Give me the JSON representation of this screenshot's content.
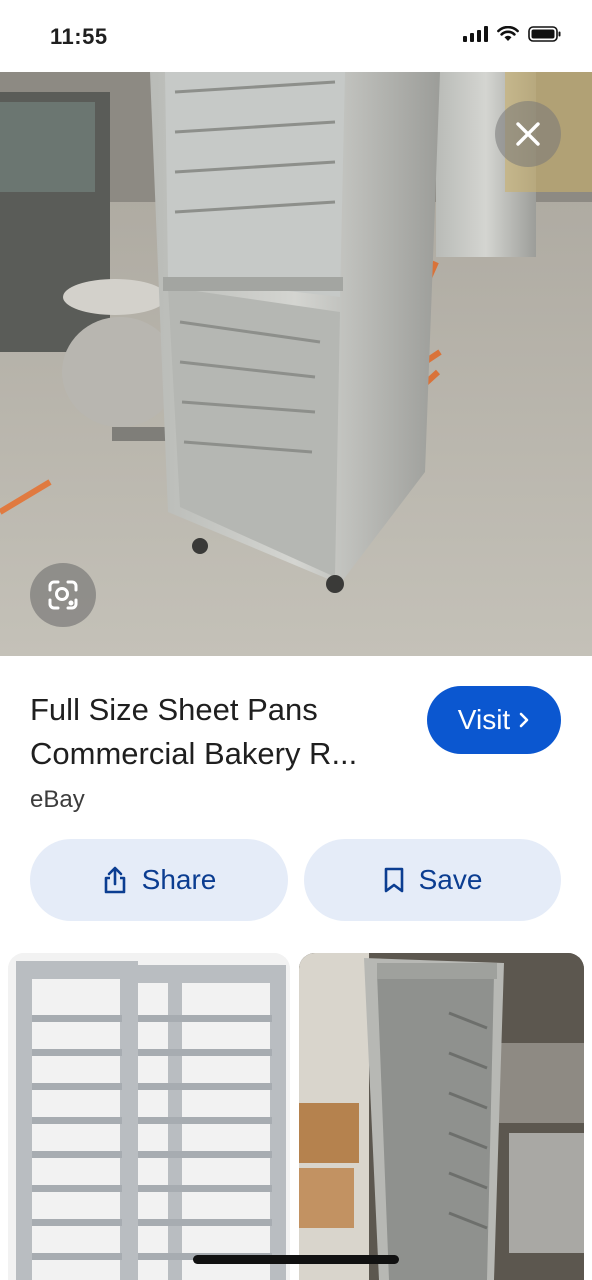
{
  "status": {
    "time": "11:55"
  },
  "result": {
    "title_line1": "Full Size Sheet Pans",
    "title_line2": "Commercial Bakery R...",
    "source": "eBay",
    "visit_label": "Visit"
  },
  "actions": {
    "share_label": "Share",
    "save_label": "Save"
  },
  "colors": {
    "accent": "#0b57d0",
    "pill_bg": "#e5ecf8",
    "pill_text": "#0b3d91"
  },
  "icons": [
    "signal-icon",
    "wifi-icon",
    "battery-icon",
    "close-icon",
    "lens-icon",
    "chevron-right-icon",
    "share-icon",
    "bookmark-icon"
  ]
}
